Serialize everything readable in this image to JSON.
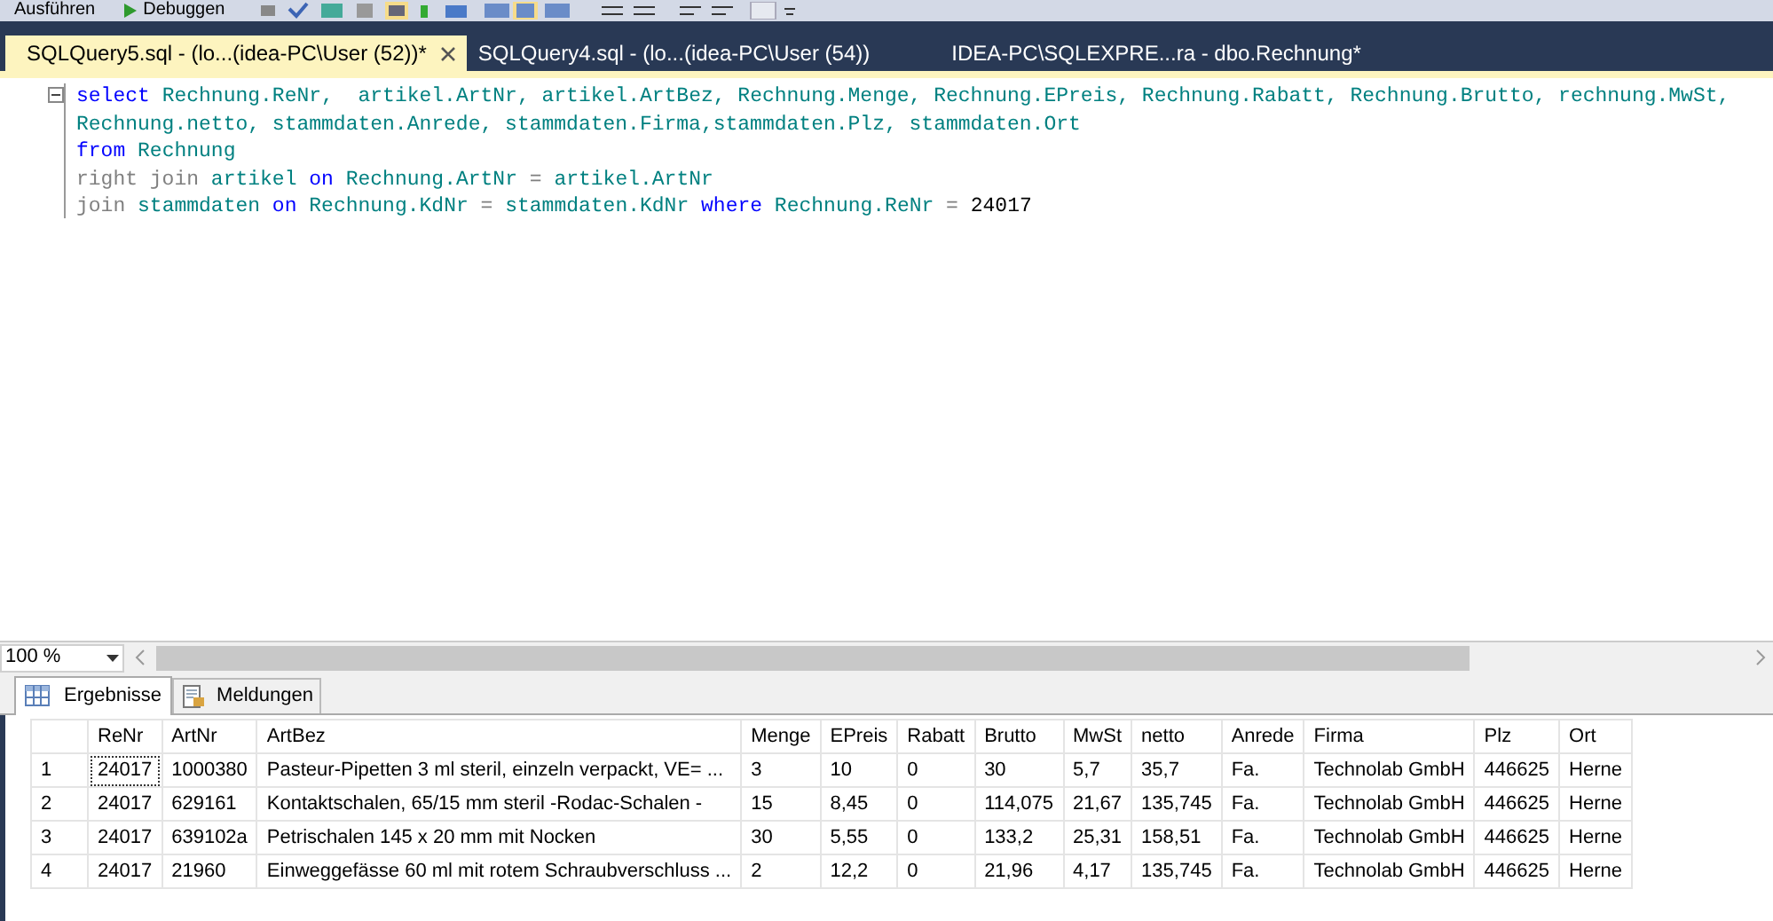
{
  "toolbar": {
    "buttons": [
      {
        "label": "Ausführen",
        "kind": "text"
      },
      {
        "label": "Debuggen",
        "kind": "play"
      }
    ]
  },
  "tabs": [
    {
      "label": "SQLQuery5.sql - (lo...(idea-PC\\User (52))*",
      "selected": true
    },
    {
      "label": "SQLQuery4.sql - (lo...(idea-PC\\User (54))",
      "selected": false
    },
    {
      "label": "IDEA-PC\\SQLEXPRE...ra - dbo.Rechnung*",
      "selected": false
    }
  ],
  "editor": {
    "lines": [
      [
        {
          "text": "select",
          "kind": "keyword"
        },
        {
          "text": " Rechnung.ReNr,  artikel.ArtNr, artikel.ArtBez, Rechnung.Menge, Rechnung.EPreis, Rechnung.Rabatt, Rechnung.Brutto, rechnung.MwSt,",
          "kind": "identifier"
        }
      ],
      [
        {
          "text": "Rechnung.netto, stammdaten.Anrede, stammdaten.Firma,stammdaten.Plz, stammdaten.Ort",
          "kind": "identifier"
        }
      ],
      [
        {
          "text": "from",
          "kind": "keyword"
        },
        {
          "text": " Rechnung",
          "kind": "identifier"
        }
      ],
      [
        {
          "text": "right join",
          "kind": "operator"
        },
        {
          "text": " artikel",
          "kind": "identifier"
        },
        {
          "text": " on",
          "kind": "keyword"
        },
        {
          "text": " Rechnung.ArtNr",
          "kind": "identifier"
        },
        {
          "text": " =",
          "kind": "operator"
        },
        {
          "text": " artikel.ArtNr",
          "kind": "identifier"
        }
      ],
      [
        {
          "text": "join",
          "kind": "operator"
        },
        {
          "text": " stammdaten",
          "kind": "identifier"
        },
        {
          "text": " on",
          "kind": "keyword"
        },
        {
          "text": " Rechnung.KdNr",
          "kind": "identifier"
        },
        {
          "text": " =",
          "kind": "operator"
        },
        {
          "text": " stammdaten.KdNr",
          "kind": "identifier"
        },
        {
          "text": " where",
          "kind": "keyword"
        },
        {
          "text": " Rechnung.ReNr",
          "kind": "identifier"
        },
        {
          "text": " =",
          "kind": "operator"
        },
        {
          "text": " 24017",
          "kind": "number"
        }
      ]
    ]
  },
  "zoom": {
    "value": "100 %"
  },
  "result_tabs": [
    {
      "label": "Ergebnisse",
      "kind": "grid",
      "selected": true
    },
    {
      "label": "Meldungen",
      "kind": "messages",
      "selected": false
    }
  ],
  "grid": {
    "columns": [
      "ReNr",
      "ArtNr",
      "ArtBez",
      "Menge",
      "EPreis",
      "Rabatt",
      "Brutto",
      "MwSt",
      "netto",
      "Anrede",
      "Firma",
      "Plz",
      "Ort"
    ],
    "rows": [
      {
        "number": "1",
        "cells": [
          {
            "text": "24017",
            "focused": true
          },
          {
            "text": "1000380",
            "focused": false
          },
          {
            "text": "Pasteur-Pipetten 3 ml steril,  einzeln verpackt, VE= ...",
            "focused": false
          },
          {
            "text": "3",
            "focused": false
          },
          {
            "text": "10",
            "focused": false
          },
          {
            "text": "0",
            "focused": false
          },
          {
            "text": "30",
            "focused": false
          },
          {
            "text": "5,7",
            "focused": false
          },
          {
            "text": "35,7",
            "focused": false
          },
          {
            "text": "Fa.",
            "focused": false
          },
          {
            "text": "Technolab GmbH",
            "focused": false
          },
          {
            "text": "446625",
            "focused": false
          },
          {
            "text": "Herne",
            "focused": false
          }
        ]
      },
      {
        "number": "2",
        "cells": [
          {
            "text": "24017",
            "focused": false
          },
          {
            "text": "629161",
            "focused": false
          },
          {
            "text": "Kontaktschalen, 65/15 mm steril -Rodac-Schalen -",
            "focused": false
          },
          {
            "text": "15",
            "focused": false
          },
          {
            "text": "8,45",
            "focused": false
          },
          {
            "text": "0",
            "focused": false
          },
          {
            "text": "114,075",
            "focused": false
          },
          {
            "text": "21,67",
            "focused": false
          },
          {
            "text": "135,745",
            "focused": false
          },
          {
            "text": "Fa.",
            "focused": false
          },
          {
            "text": "Technolab GmbH",
            "focused": false
          },
          {
            "text": "446625",
            "focused": false
          },
          {
            "text": "Herne",
            "focused": false
          }
        ]
      },
      {
        "number": "3",
        "cells": [
          {
            "text": "24017",
            "focused": false
          },
          {
            "text": "639102a",
            "focused": false
          },
          {
            "text": "Petrischalen 145 x 20 mm mit Nocken",
            "focused": false
          },
          {
            "text": "30",
            "focused": false
          },
          {
            "text": "5,55",
            "focused": false
          },
          {
            "text": "0",
            "focused": false
          },
          {
            "text": "133,2",
            "focused": false
          },
          {
            "text": "25,31",
            "focused": false
          },
          {
            "text": "158,51",
            "focused": false
          },
          {
            "text": "Fa.",
            "focused": false
          },
          {
            "text": "Technolab GmbH",
            "focused": false
          },
          {
            "text": "446625",
            "focused": false
          },
          {
            "text": "Herne",
            "focused": false
          }
        ]
      },
      {
        "number": "4",
        "cells": [
          {
            "text": "24017",
            "focused": false
          },
          {
            "text": "21960",
            "focused": false
          },
          {
            "text": "Einweggefässe 60 ml mit rotem Schraubverschluss ...",
            "focused": false
          },
          {
            "text": "2",
            "focused": false
          },
          {
            "text": "12,2",
            "focused": false
          },
          {
            "text": "0",
            "focused": false
          },
          {
            "text": "21,96",
            "focused": false
          },
          {
            "text": "4,17",
            "focused": false
          },
          {
            "text": "135,745",
            "focused": false
          },
          {
            "text": "Fa.",
            "focused": false
          },
          {
            "text": "Technolab GmbH",
            "focused": false
          },
          {
            "text": "446625",
            "focused": false
          },
          {
            "text": "Herne",
            "focused": false
          }
        ]
      }
    ]
  }
}
